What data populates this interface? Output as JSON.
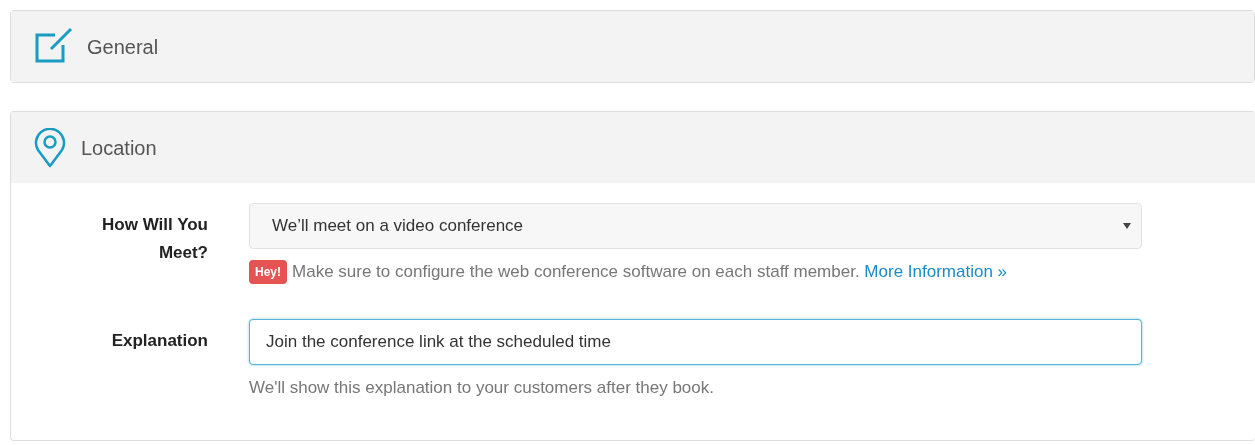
{
  "sections": [
    {
      "kind": "edit",
      "title": "General",
      "expanded": false
    },
    {
      "kind": "location",
      "title": "Location",
      "expanded": true
    }
  ],
  "fields": [
    {
      "kind": "select",
      "label": "How Will You Meet?",
      "value": "We’ll meet on a video conference",
      "badge": "Hey!",
      "help": "Make sure to configure the web conference software on each staff member.",
      "link": "More Information »"
    },
    {
      "kind": "text",
      "label": "Explanation",
      "value": "Join the conference link at the scheduled time",
      "focused": true,
      "help": "We'll show this explanation to your customers after they book."
    }
  ]
}
